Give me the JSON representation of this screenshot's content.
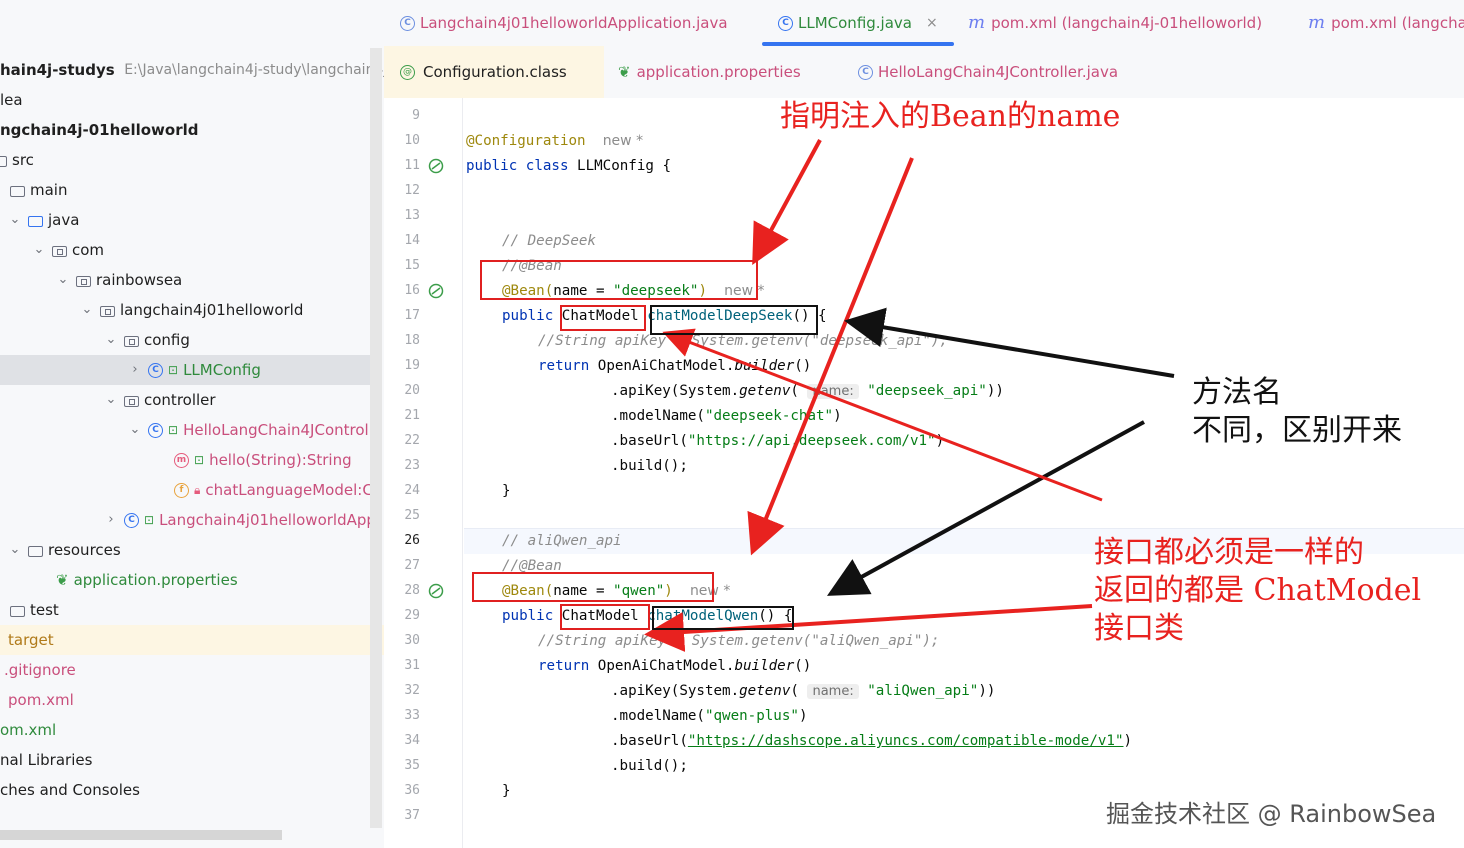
{
  "tree": {
    "rows": [
      {
        "label": "hain4j-studys",
        "extra": "E:\\Java\\langchain4j-study\\langchain4j-",
        "bold": true
      },
      {
        "label": "lea"
      },
      {
        "label": "ngchain4j-01helloworld",
        "bold": true
      },
      {
        "label": "src"
      },
      {
        "label": "main"
      },
      {
        "label": "java"
      },
      {
        "label": "com"
      },
      {
        "label": "rainbowsea"
      },
      {
        "label": "langchain4j01helloworld"
      },
      {
        "label": "config"
      },
      {
        "label": "LLMConfig"
      },
      {
        "label": "controller"
      },
      {
        "label": "HelloLangChain4JControll"
      },
      {
        "label": "hello(String):String"
      },
      {
        "label": "chatLanguageModel:C"
      },
      {
        "label": "Langchain4j01helloworldApp"
      },
      {
        "label": "resources"
      },
      {
        "label": "application.properties"
      },
      {
        "label": "test"
      },
      {
        "label": "target"
      },
      {
        "label": ".gitignore"
      },
      {
        "label": "pom.xml"
      },
      {
        "label": "om.xml"
      },
      {
        "label": "nal Libraries"
      },
      {
        "label": "ches and Consoles"
      }
    ]
  },
  "tabs_row1": [
    {
      "label": "Langchain4j01helloworldApplication.java"
    },
    {
      "label": "LLMConfig.java",
      "active": true,
      "close": "×"
    },
    {
      "label": "pom.xml (langchain4j-01helloworld)"
    },
    {
      "label": "pom.xml (langcha"
    }
  ],
  "tabs_row2": [
    {
      "label": "Configuration.class"
    },
    {
      "label": "application.properties"
    },
    {
      "label": "HelloLangChain4JController.java"
    }
  ],
  "editor": {
    "line_numbers": [
      "9",
      "10",
      "11",
      "12",
      "13",
      "14",
      "15",
      "16",
      "17",
      "18",
      "19",
      "20",
      "21",
      "22",
      "23",
      "24",
      "25",
      "26",
      "27",
      "28",
      "29",
      "30",
      "31",
      "32",
      "33",
      "34",
      "35",
      "36",
      "37"
    ],
    "lines": {
      "l10_ann": "@Configuration",
      "l10_author": "new *",
      "l11_kw": "public class ",
      "l11_name": "LLMConfig {",
      "l14": "// DeepSeek",
      "l15": "//@Bean",
      "l16_ann": "@Bean(",
      "l16_name": "name = ",
      "l16_str": "\"deepseek\"",
      "l16_close": ")",
      "l16_author": "new *",
      "l17_kw": "public ",
      "l17_type": "ChatModel",
      "l17_fn": "chatModelDeepSeek",
      "l17_rest": "() {",
      "l18": "//String apiKey = System.getenv(\"deepseek_api\");",
      "l19_kw": "return ",
      "l19_rest": "OpenAiChatModel.",
      "l19_builder": "builder",
      "l19_end": "()",
      "l20_a": ".apiKey(System.",
      "l20_b": "getenv",
      "l20_c": "(",
      "l20_hint": "name:",
      "l20_str": "\"deepseek_api\"",
      "l20_d": "))",
      "l21_a": ".modelName(",
      "l21_str": "\"deepseek-chat\"",
      "l21_b": ")",
      "l22_a": ".baseUrl(",
      "l22_str": "\"https://api.deepseek.com/v1\"",
      "l22_b": ")",
      "l23": ".build();",
      "l24": "}",
      "l26": "// aliQwen_api",
      "l27": "//@Bean",
      "l28_ann": "@Bean(",
      "l28_name": "name = ",
      "l28_str": "\"qwen\"",
      "l28_close": ")",
      "l28_author": "new *",
      "l29_kw": "public ",
      "l29_type": "ChatModel",
      "l29_fn": "chatModelQwen",
      "l29_rest": "() {",
      "l30": "//String apiKey = System.getenv(\"aliQwen_api\");",
      "l31_kw": "return ",
      "l31_rest": "OpenAiChatModel.",
      "l31_builder": "builder",
      "l31_end": "()",
      "l32_a": ".apiKey(System.",
      "l32_b": "getenv",
      "l32_c": "(",
      "l32_hint": "name:",
      "l32_str": "\"aliQwen_api\"",
      "l32_d": "))",
      "l33_a": ".modelName(",
      "l33_str": "\"qwen-plus\"",
      "l33_b": ")",
      "l34_a": ".baseUrl(",
      "l34_str": "\"https://dashscope.aliyuncs.com/compatible-mode/v1\"",
      "l34_b": ")",
      "l35": ".build();",
      "l36": "}"
    }
  },
  "annotations": {
    "note_bean_name": "指明注入的Bean的name",
    "note_method": "方法名\n不同，区别开来",
    "note_interface": "接口都必须是一样的\n返回的都是 ChatModel\n接口类",
    "watermark": "掘金技术社区 @ RainbowSea",
    "colors": {
      "red": "#e8221f",
      "black": "#111111"
    }
  }
}
